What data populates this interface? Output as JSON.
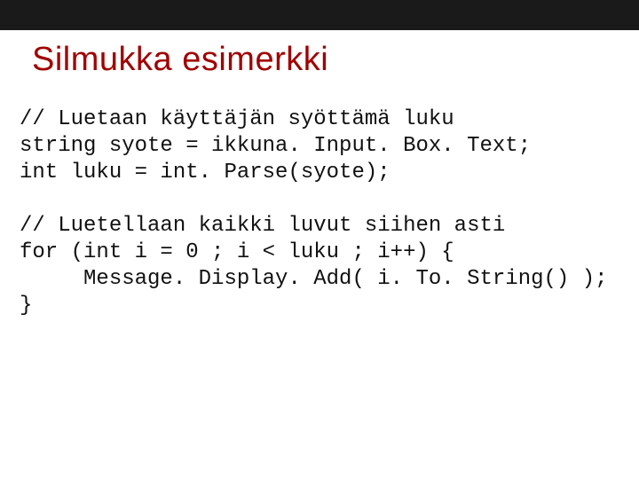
{
  "title": "Silmukka esimerkki",
  "code": [
    "// Luetaan käyttäjän syöttämä luku",
    "string syote = ikkuna. Input. Box. Text;",
    "int luku = int. Parse(syote);",
    "// Luetellaan kaikki luvut siihen asti",
    "for (int i = 0 ; i < luku ; i++) {",
    "     Message. Display. Add( i. To. String() );",
    "}"
  ]
}
